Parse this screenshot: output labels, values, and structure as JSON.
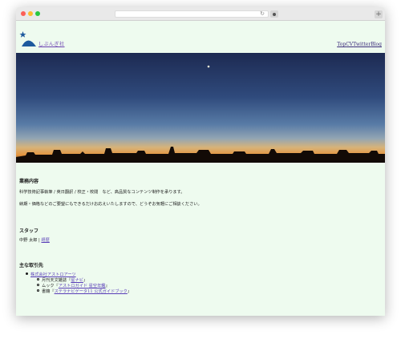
{
  "browser": {
    "reload_glyph": "↻",
    "newtab_glyph": "+"
  },
  "header": {
    "site_name": "しぶんぎ社",
    "nav": [
      "Top",
      "CV",
      "Twitter",
      "Blog"
    ]
  },
  "sections": {
    "business": {
      "title": "業務内容",
      "line1": "科学技術記事執筆 / 英日翻訳 / 校正・校閲　など、高品質なコンテンツ制作を承ります。",
      "line2": "納期・価格などのご要望にもできるだけお応えいたしますので、どうぞお気軽にご相談ください。"
    },
    "staff": {
      "title": "スタッフ",
      "name": "中野 太郎",
      "sep": " | ",
      "link": "経歴"
    },
    "clients": {
      "title": "主な取引先",
      "company": "株式会社アストロアーツ",
      "items": [
        {
          "prefix": "月刊天文雑誌『",
          "link": "星ナビ",
          "suffix": "』"
        },
        {
          "prefix": "ムック『",
          "link": "アストロガイド 星空年鑑",
          "suffix": "』"
        },
        {
          "prefix": "書籍『",
          "link": "ステラナビゲータ11 公式ガイドブック",
          "suffix": "』"
        }
      ]
    }
  },
  "colors": {
    "page_bg": "#eefbef",
    "link": "#5a3fb8",
    "logo": "#1e5a9e"
  }
}
